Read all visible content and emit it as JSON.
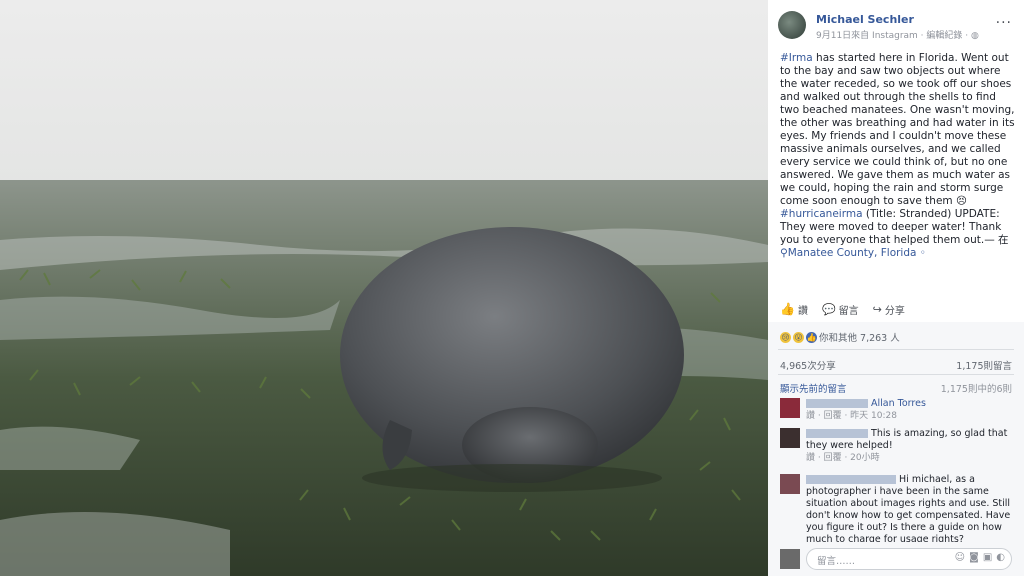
{
  "header": {
    "name": "Michael Sechler",
    "meta": "9月11日來自 Instagram · 編輯紀錄 · ",
    "more": "..."
  },
  "post": {
    "hashtag1": "#Irma",
    "body1": " has started here in Florida. Went out to the bay and saw two objects out where the water receded, so we took off our shoes and walked out through the shells to find two beached manatees. One wasn't moving, the other was breathing and had water in its eyes. My friends and I couldn't move these massive animals ourselves, and we called every service we could think of, but no one answered. We gave them as much water as we could, hoping the rain and storm surge come soon enough to save them ",
    "emoji": "😣",
    "hashtag2": " #hurricaneirma",
    "body2": " (Title: Stranded) UPDATE: They were moved to deeper water! Thank you to everyone that helped them out.— 在",
    "location": "Manatee County, Florida",
    "tail": " ◦"
  },
  "actions": {
    "like": "讚",
    "comment": "留言",
    "share": "分享"
  },
  "reactions": {
    "text": "你和其他 7,263 人"
  },
  "stats": {
    "shares": "4,965次分享",
    "comments": "1,175則留言"
  },
  "previous": {
    "label": "顯示先前的留言",
    "count": "1,175則中的6則"
  },
  "comments": [
    {
      "name": "Allan Torres",
      "text": "",
      "meta": "讚 · 回覆 · 昨天 10:28"
    },
    {
      "name": "",
      "text": "This is amazing, so glad that they were helped!",
      "meta": "讚 · 回覆 · 20小時"
    },
    {
      "name": "",
      "text": "Hi michael, as a photographer i have been in the same situation about images rights and use. Still don't know how to get compensated. Have you figure it out? Is there a guide on how much to charge for usage rights?",
      "meta": ""
    }
  ],
  "composer": {
    "placeholder": "留言……"
  },
  "colors": {
    "link": "#365899",
    "panel_bg": "#ffffff",
    "footer_bg": "#f6f7f9"
  }
}
